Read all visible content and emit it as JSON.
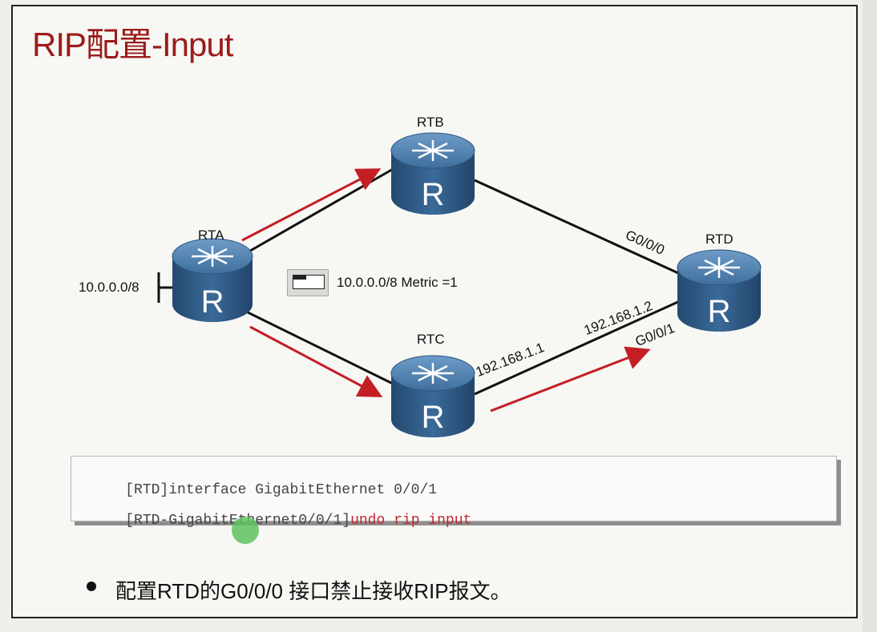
{
  "title": "RIP配置-Input",
  "routers": [
    {
      "name": "RTA"
    },
    {
      "name": "RTB"
    },
    {
      "name": "RTC"
    },
    {
      "name": "RTD"
    }
  ],
  "router_glyph": "R",
  "labels": {
    "network": "10.0.0.0/8",
    "legend": "10.0.0.0/8 Metric =1",
    "rtc_ip": "192.168.1.1",
    "rtd_ip": "192.168.1.2",
    "rtd_g000": "G0/0/0",
    "rtd_g001": "G0/0/1"
  },
  "commands": [
    {
      "prompt": "[RTD]interface GigabitEthernet 0/0/1",
      "highlight": ""
    },
    {
      "prompt": "[RTD-GigabitEthernet0/0/1]",
      "highlight": "undo rip input"
    }
  ],
  "bullet": "配置RTD的G0/0/0 接口禁止接收RIP报文。",
  "colors": {
    "title": "#9b1b1b",
    "arrow": "#c41e25",
    "router_top": "#4d7fae",
    "router_body": "#2e5b88",
    "command_highlight": "#c0282e"
  }
}
